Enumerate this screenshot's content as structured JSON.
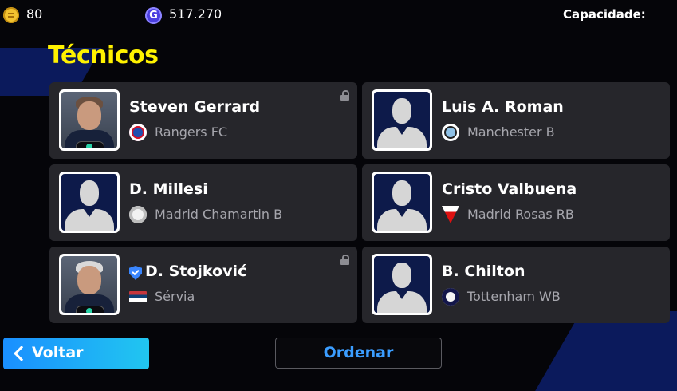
{
  "header": {
    "coins": "80",
    "gp": "517.270",
    "gp_symbol": "G",
    "capacity_label": "Capacidade:"
  },
  "title": "Técnicos",
  "managers": [
    {
      "name": "Steven Gerrard",
      "club": "Rangers FC",
      "photo": true,
      "locked": true,
      "verified": false,
      "club_icon": "rangers-crest-icon"
    },
    {
      "name": "Luis A. Roman",
      "club": "Manchester B",
      "photo": false,
      "locked": false,
      "verified": false,
      "club_icon": "manchester-crest-icon"
    },
    {
      "name": "D. Millesi",
      "club": "Madrid Chamartin B",
      "photo": false,
      "locked": false,
      "verified": false,
      "club_icon": "madrid-chamartin-crest-icon"
    },
    {
      "name": "Cristo Valbuena",
      "club": "Madrid Rosas RB",
      "photo": false,
      "locked": false,
      "verified": false,
      "club_icon": "madrid-rosas-crest-icon"
    },
    {
      "name": "D. Stojković",
      "club": "Sérvia",
      "photo": true,
      "locked": true,
      "verified": true,
      "club_icon": "serbia-flag-icon"
    },
    {
      "name": "B. Chilton",
      "club": "Tottenham WB",
      "photo": false,
      "locked": false,
      "verified": false,
      "club_icon": "tottenham-crest-icon"
    }
  ],
  "buttons": {
    "back": "Voltar",
    "sort": "Ordenar"
  },
  "colors": {
    "title": "#fff200",
    "accent": "#1a8fff",
    "sort_text": "#3b9dff",
    "card": "#26262b"
  }
}
